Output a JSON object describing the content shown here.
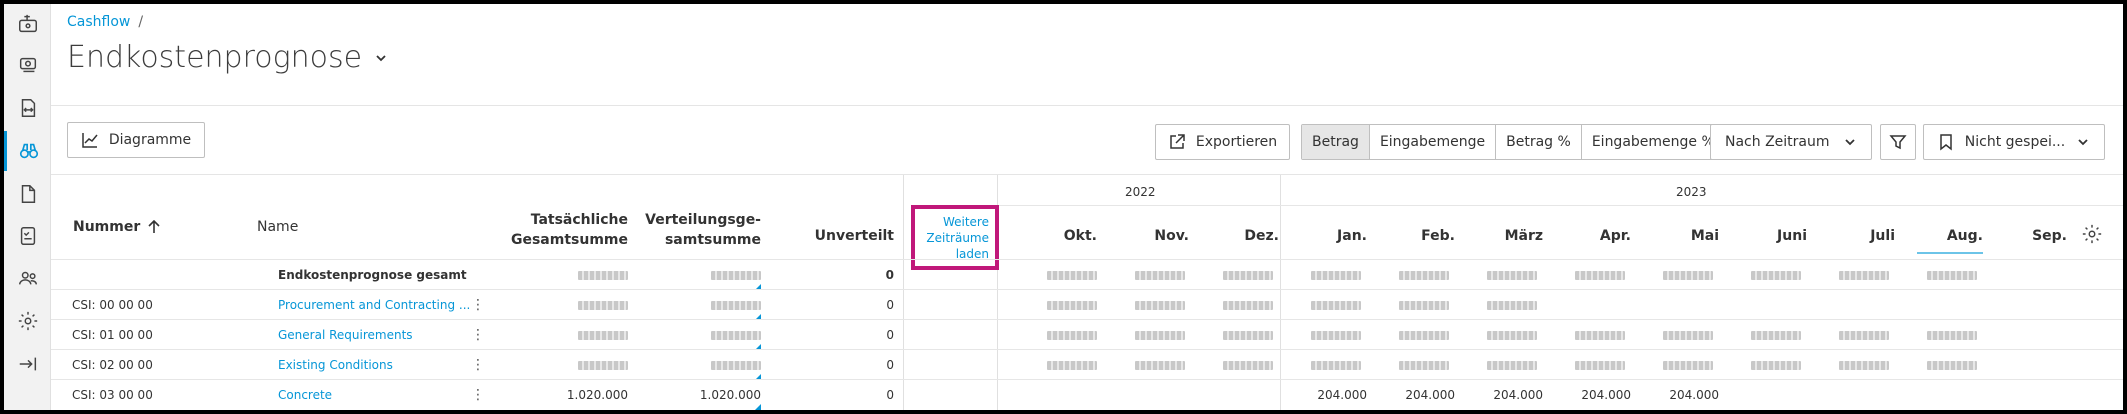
{
  "breadcrumb": {
    "root": "Cashflow",
    "separator": "/"
  },
  "page": {
    "title": "Endkostenprognose"
  },
  "toolbar": {
    "charts_label": "Diagramme",
    "export_label": "Exportieren",
    "modes": [
      "Betrag",
      "Eingabemenge",
      "Betrag %",
      "Eingabemenge %"
    ],
    "active_mode": "Betrag",
    "period_select": "Nach Zeitraum",
    "view_select": "Nicht gespei..."
  },
  "table": {
    "headers": {
      "number": "Nummer",
      "name": "Name",
      "actual_line1": "Tatsächliche",
      "actual_line2": "Gesamtsumme",
      "dist_line1": "Verteilungsge-",
      "dist_line2": "samtsumme",
      "unallocated": "Unverteilt",
      "more_line1": "Weitere",
      "more_line2": "Zeiträume",
      "more_line3": "laden"
    },
    "years": [
      "2022",
      "2023"
    ],
    "months": [
      "Okt.",
      "Nov.",
      "Dez.",
      "Jan.",
      "Feb.",
      "März",
      "Apr.",
      "Mai",
      "Juni",
      "Juli",
      "Aug.",
      "Sep."
    ],
    "rows": [
      {
        "number": "",
        "name": "Endkostenprognose gesamt",
        "actual": "",
        "dist": "",
        "unallocated": "0",
        "months": []
      },
      {
        "number": "CSI: 00 00 00",
        "name": "Procurement and Contracting ...",
        "actual": "",
        "dist": "",
        "unallocated": "0",
        "months": []
      },
      {
        "number": "CSI: 01 00 00",
        "name": "General Requirements",
        "actual": "",
        "dist": "",
        "unallocated": "0",
        "months": []
      },
      {
        "number": "CSI: 02 00 00",
        "name": "Existing Conditions",
        "actual": "",
        "dist": "",
        "unallocated": "0",
        "months": []
      },
      {
        "number": "CSI: 03 00 00",
        "name": "Concrete",
        "actual": "1.020.000",
        "dist": "1.020.000",
        "unallocated": "0",
        "months": [
          "",
          "",
          "",
          "204.000",
          "204.000",
          "204.000",
          "204.000",
          "204.000",
          "",
          "",
          "",
          ""
        ]
      }
    ]
  },
  "colors": {
    "accent": "#0696d7",
    "highlight_border": "#c0187a"
  },
  "icons": [
    "import-icon",
    "money-icon",
    "compare-icon",
    "binoculars-icon",
    "document-icon",
    "checklist-icon",
    "users-icon",
    "gear-icon",
    "collapse-icon"
  ]
}
